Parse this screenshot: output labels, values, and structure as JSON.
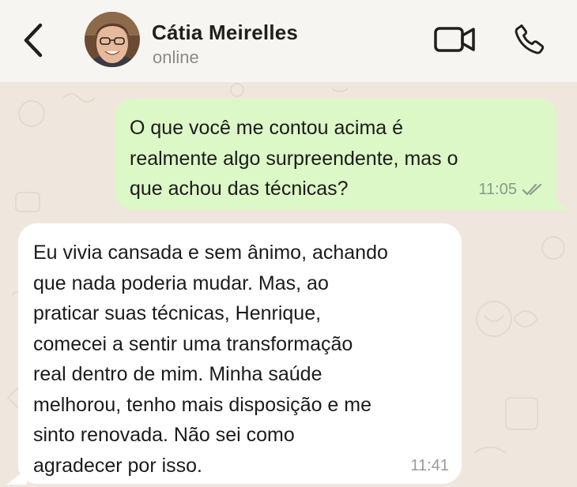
{
  "header": {
    "contact_name": "Cátia Meirelles",
    "status": "online",
    "icons": {
      "back": "chevron-left-icon",
      "video": "video-camera-icon",
      "call": "phone-icon"
    }
  },
  "messages": [
    {
      "direction": "outgoing",
      "text": "O que você me contou acima é\nrealmente algo surpreendente, mas o\nque achou das técnicas?",
      "time": "11:05",
      "status_icon": "double-check-icon"
    },
    {
      "direction": "incoming",
      "text": "Eu vivia cansada e sem ânimo, achando\nque nada poderia mudar. Mas, ao\npraticar suas técnicas, Henrique,\ncomecei a sentir uma transformação\nreal dentro de mim. Minha saúde\nmelhorou, tenho mais disposição e me\nsinto renovada. Não sei como\nagradecer por isso.",
      "time": "11:41"
    }
  ],
  "colors": {
    "header_bg": "#f7f5f1",
    "chat_bg": "#efe7dd",
    "outgoing_bubble": "#dcf8c6",
    "incoming_bubble": "#ffffff"
  }
}
